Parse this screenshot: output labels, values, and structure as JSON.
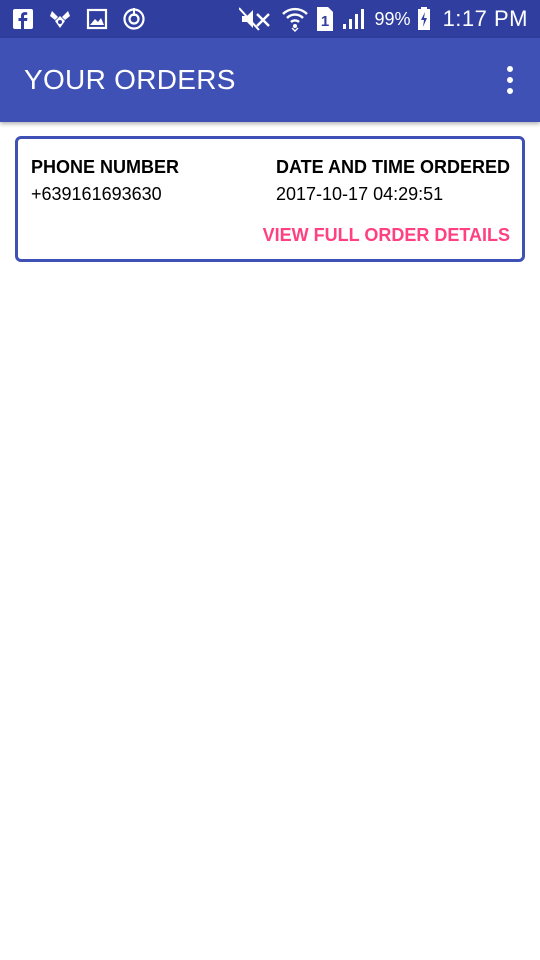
{
  "status_bar": {
    "icons_left": [
      "facebook-icon",
      "bug-icon",
      "gallery-icon",
      "sync-icon"
    ],
    "icons_right": [
      "mute-icon",
      "wifi-icon",
      "sim-icon",
      "signal-icon"
    ],
    "sim_number": "1",
    "battery": "99%",
    "time": "1:17 PM"
  },
  "app_bar": {
    "title": "YOUR ORDERS",
    "menu_icon": "more-vert-icon"
  },
  "orders": [
    {
      "phone_label": "PHONE NUMBER",
      "phone_value": "+639161693630",
      "date_label": "DATE AND TIME ORDERED",
      "date_value": "2017-10-17 04:29:51",
      "action_label": "VIEW FULL ORDER DETAILS"
    }
  ],
  "colors": {
    "status_bar": "#303f9f",
    "primary": "#3f51b5",
    "accent": "#ff4081"
  }
}
